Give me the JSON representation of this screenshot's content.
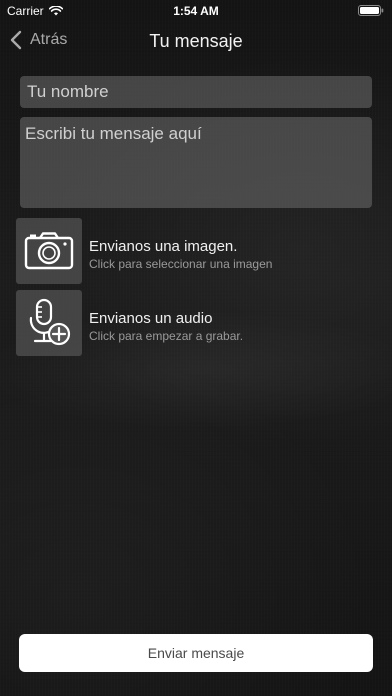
{
  "status_bar": {
    "carrier": "Carrier",
    "time": "1:54 AM"
  },
  "nav": {
    "back_label": "Atrás",
    "title": "Tu mensaje"
  },
  "form": {
    "name_placeholder": "Tu nombre",
    "message_placeholder": "Escribi tu mensaje aquí"
  },
  "actions": [
    {
      "icon": "camera-icon",
      "title": "Envianos una imagen.",
      "subtitle": "Click para seleccionar una imagen"
    },
    {
      "icon": "microphone-add-icon",
      "title": "Envianos un audio",
      "subtitle": "Click para empezar a grabar."
    }
  ],
  "send_button": {
    "label": "Enviar mensaje"
  }
}
